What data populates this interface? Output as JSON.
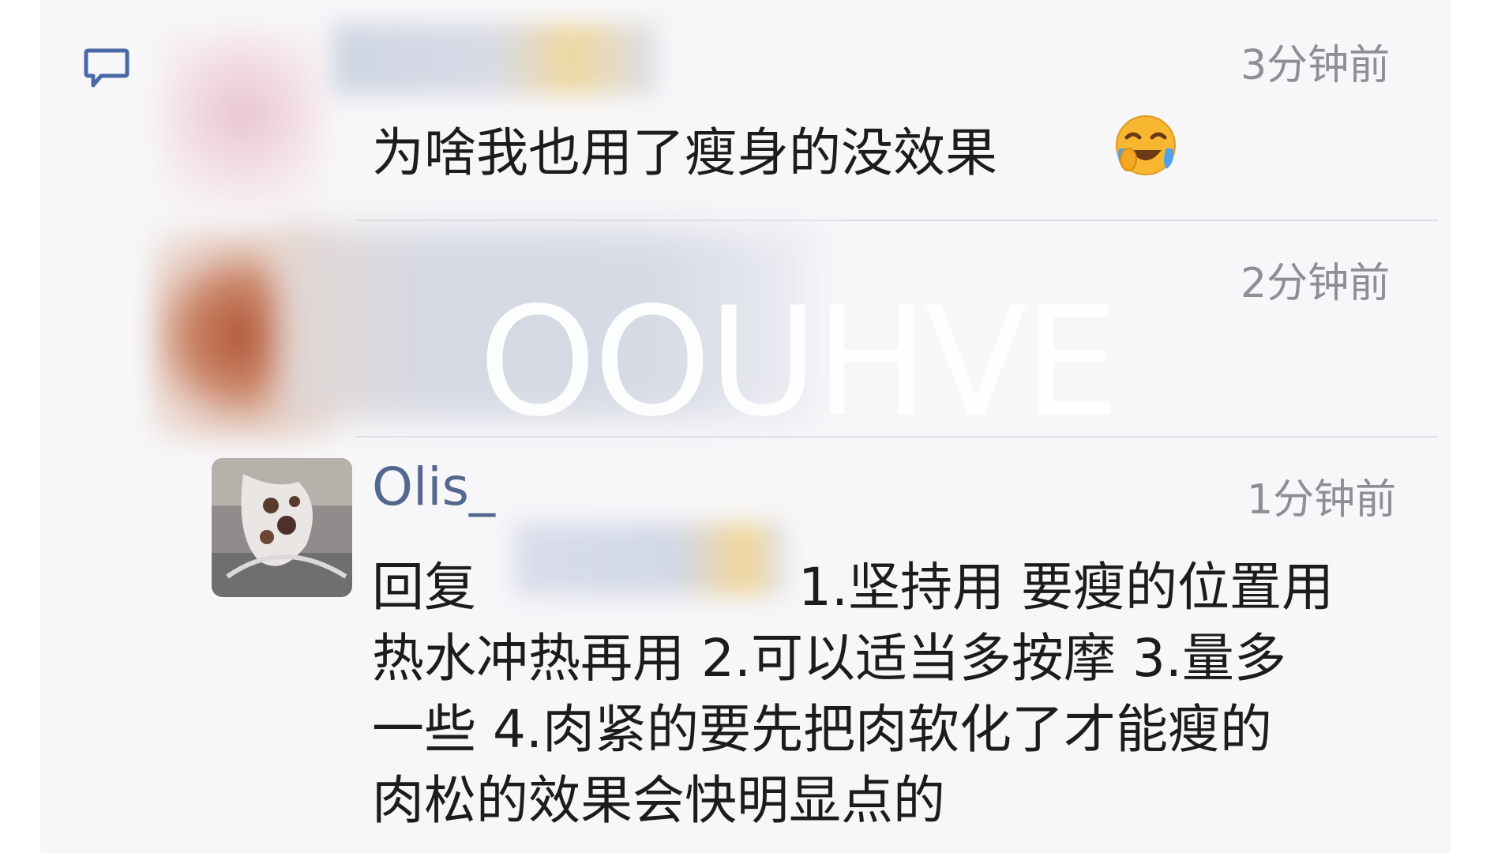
{
  "comments": [
    {
      "timestamp": "3分钟前",
      "text": "为啥我也用了瘦身的没效果",
      "emoji": "face-with-tears-of-joy-emoji"
    },
    {
      "timestamp": "2分钟前",
      "watermark": "OOUHVE"
    },
    {
      "username": "Olis_",
      "timestamp": "1分钟前",
      "reply_prefix": "回复",
      "reply_lines": [
        "1.坚持用 要瘦的位置用",
        "热水冲热再用 2.可以适当多按摩 3.量多",
        "一些 4.肉紧的要先把肉软化了才能瘦的",
        "肉松的效果会快明显点的"
      ]
    }
  ],
  "icons": {
    "comment": "comment-bubble-icon"
  },
  "colors": {
    "username": "#54688f",
    "timestamp": "#8e8e93",
    "text": "#1c1c1e",
    "icon": "#4a6aa5",
    "panel_bg": "#f7f7f9"
  }
}
